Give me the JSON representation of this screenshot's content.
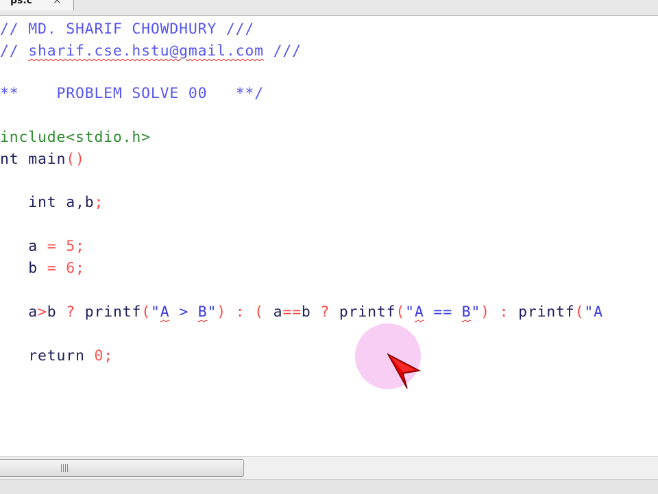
{
  "tab": {
    "label": "ps.c",
    "close_glyph": "×"
  },
  "code": [
    {
      "id": "l1",
      "segments": [
        {
          "text": "// MD. SHARIF CHOWDHURY ///",
          "cls": "c-comment"
        }
      ]
    },
    {
      "id": "l2",
      "segments": [
        {
          "text": "// ",
          "cls": "c-comment"
        },
        {
          "text": "sharif.cse.hstu@gmail.com",
          "cls": "c-comment squiggle"
        },
        {
          "text": " ///",
          "cls": "c-comment"
        }
      ]
    },
    {
      "id": "l3",
      "segments": [
        {
          "text": "**    PROBLEM SOLVE 00   **/",
          "cls": "c-comment"
        }
      ]
    },
    {
      "id": "l4",
      "segments": [
        {
          "text": "include<stdio.h>",
          "cls": "c-pre"
        }
      ]
    },
    {
      "id": "l5",
      "segments": [
        {
          "text": "nt main",
          "cls": "c-kw"
        },
        {
          "text": "()",
          "cls": "c-op"
        }
      ]
    },
    {
      "id": "l6",
      "segments": [
        {
          "text": "   int a,b",
          "cls": "c-plain"
        },
        {
          "text": ";",
          "cls": "c-op"
        }
      ]
    },
    {
      "id": "l7",
      "segments": [
        {
          "text": "   a ",
          "cls": "c-plain"
        },
        {
          "text": "=",
          "cls": "c-op"
        },
        {
          "text": " ",
          "cls": "c-plain"
        },
        {
          "text": "5",
          "cls": "c-num"
        },
        {
          "text": ";",
          "cls": "c-op"
        }
      ]
    },
    {
      "id": "l8",
      "segments": [
        {
          "text": "   b ",
          "cls": "c-plain"
        },
        {
          "text": "=",
          "cls": "c-op"
        },
        {
          "text": " ",
          "cls": "c-plain"
        },
        {
          "text": "6",
          "cls": "c-num"
        },
        {
          "text": ";",
          "cls": "c-op"
        }
      ]
    },
    {
      "id": "l9",
      "segments": [
        {
          "text": "   a",
          "cls": "c-plain"
        },
        {
          "text": ">",
          "cls": "c-op"
        },
        {
          "text": "b ",
          "cls": "c-plain"
        },
        {
          "text": "?",
          "cls": "c-op"
        },
        {
          "text": " printf",
          "cls": "c-plain"
        },
        {
          "text": "(",
          "cls": "c-op"
        },
        {
          "text": "\"",
          "cls": "c-str"
        },
        {
          "text": "A",
          "cls": "c-str squiggle"
        },
        {
          "text": " > ",
          "cls": "c-str"
        },
        {
          "text": "B",
          "cls": "c-str squiggle"
        },
        {
          "text": "\"",
          "cls": "c-str"
        },
        {
          "text": ")",
          "cls": "c-op"
        },
        {
          "text": " : ",
          "cls": "c-op"
        },
        {
          "text": "(",
          "cls": "c-op"
        },
        {
          "text": " a",
          "cls": "c-plain"
        },
        {
          "text": "==",
          "cls": "c-op"
        },
        {
          "text": "b ",
          "cls": "c-plain"
        },
        {
          "text": "?",
          "cls": "c-op"
        },
        {
          "text": " printf",
          "cls": "c-plain"
        },
        {
          "text": "(",
          "cls": "c-op"
        },
        {
          "text": "\"",
          "cls": "c-str"
        },
        {
          "text": "A",
          "cls": "c-str squiggle"
        },
        {
          "text": " == ",
          "cls": "c-str"
        },
        {
          "text": "B",
          "cls": "c-str squiggle"
        },
        {
          "text": "\"",
          "cls": "c-str"
        },
        {
          "text": ")",
          "cls": "c-op"
        },
        {
          "text": " : ",
          "cls": "c-op"
        },
        {
          "text": "printf",
          "cls": "c-plain"
        },
        {
          "text": "(",
          "cls": "c-op"
        },
        {
          "text": "\"A",
          "cls": "c-str"
        }
      ]
    },
    {
      "id": "l10",
      "segments": [
        {
          "text": "   return ",
          "cls": "c-plain"
        },
        {
          "text": "0",
          "cls": "c-num"
        },
        {
          "text": ";",
          "cls": "c-op"
        }
      ]
    }
  ],
  "colors": {
    "comment": "#5555ee",
    "preprocessor": "#2e8b2e",
    "keyword": "#1f1f5f",
    "number": "#ff5555",
    "string": "#3a3adf",
    "cursor_halo": "#f5bef0",
    "cursor_arrow": "#e00000"
  },
  "icons": {
    "cursor": "pointer-arrow-icon",
    "scroll_grip": "grip-icon"
  }
}
